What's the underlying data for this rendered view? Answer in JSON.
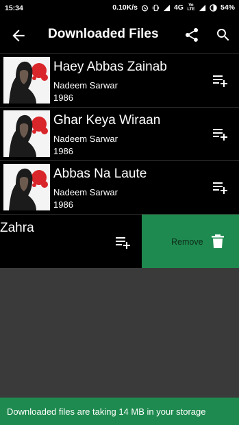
{
  "status_bar": {
    "time": "15:34",
    "net_speed": "0.10K/s",
    "network": "4G",
    "volte": "Vo LTE",
    "battery": "54%"
  },
  "app_bar": {
    "title": "Downloaded Files",
    "back_icon": "arrow-left-icon",
    "share_icon": "share-icon",
    "search_icon": "search-icon"
  },
  "downloads": [
    {
      "title": "Haey Abbas Zainab",
      "artist": "Nadeem Sarwar",
      "year": "1986"
    },
    {
      "title": "Ghar Keya Wiraan",
      "artist": "Nadeem Sarwar",
      "year": "1986"
    },
    {
      "title": "Abbas Na Laute",
      "artist": "Nadeem Sarwar",
      "year": "1986"
    }
  ],
  "swiped_item": {
    "title": "Zahra",
    "remove_label": "Remove",
    "remove_icon": "trash-icon"
  },
  "storage_banner": {
    "text": "Downloaded files are taking 14 MB in your storage"
  },
  "colors": {
    "accent_green": "#1e8a4f",
    "background": "#3a3a3a",
    "row_background": "#000000",
    "thumb_red_splash": "#d9262a"
  }
}
